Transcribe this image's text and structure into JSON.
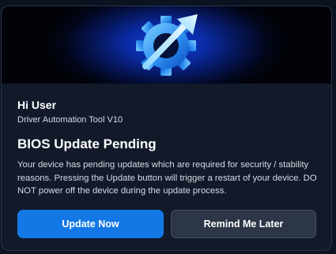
{
  "greeting": "Hi User",
  "app_name": "Driver Automation Tool V10",
  "dialog_title": "BIOS Update Pending",
  "message": "Your device has pending updates which are required for security / stability reasons. Pressing the Update button will trigger a restart of your device. DO NOT power off the device during the update process.",
  "buttons": {
    "primary_label": "Update Now",
    "secondary_label": "Remind Me Later"
  },
  "banner_icon": "gear-with-arrow-icon",
  "colors": {
    "accent": "#1378e6",
    "card_background": "#121a2a",
    "secondary_button": "#2c3647"
  }
}
